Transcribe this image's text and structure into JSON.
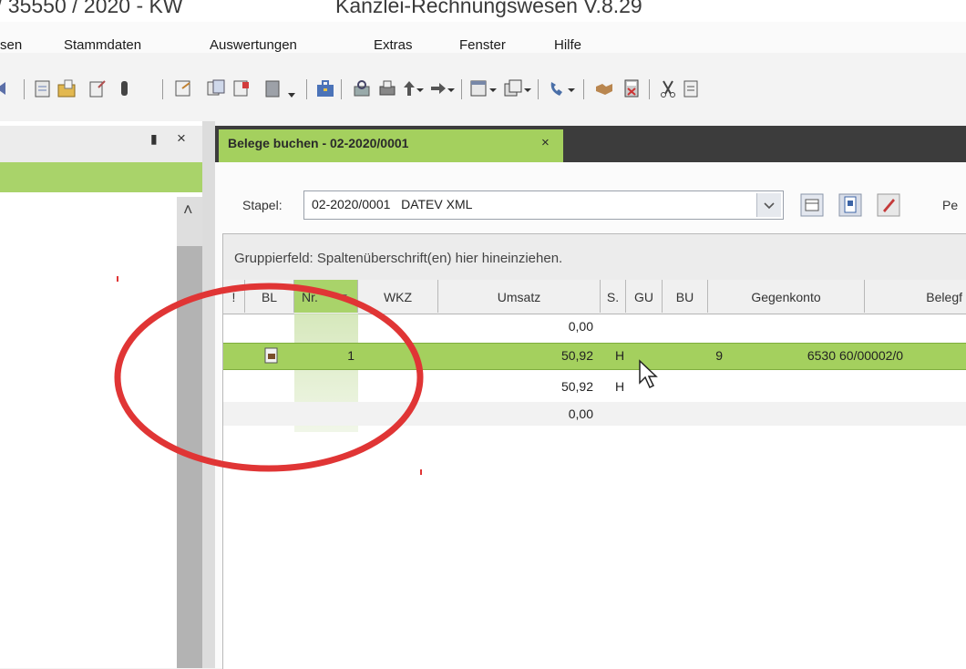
{
  "window": {
    "title": "/ 35550 / 2020 - KW",
    "app_title": "Kanzlei-Rechnungswesen V.8.29"
  },
  "menu": [
    "sen",
    "Stammdaten",
    "Auswertungen",
    "Extras",
    "Fenster",
    "Hilfe"
  ],
  "toolbar": {
    "icons": [
      "arrow-icon",
      "document-icon",
      "folder-open-icon",
      "document-edit-icon",
      "attach-icon",
      "page-icon",
      "copy-icon",
      "page-delete-icon",
      "archive-icon",
      "dropdown-icon",
      "briefcase-icon",
      "print-preview-icon",
      "printer-icon",
      "arrow-up-icon",
      "arrow-right-icon",
      "window-icon",
      "window-stack-icon",
      "phone-icon",
      "handshake-icon",
      "calculator-icon",
      "scissors-icon",
      "clipboard-icon"
    ]
  },
  "left_panel": {
    "pin_label": "▮",
    "close_label": "×",
    "scroll_up": "˄"
  },
  "doc_tab": {
    "label": "Belege buchen  - 02-2020/0001",
    "close": "×"
  },
  "stapel": {
    "label": "Stapel:",
    "value": "02-2020/0001   DATEV XML",
    "extra": "Pe"
  },
  "grid": {
    "group_hint": "Gruppierfeld: Spaltenüberschrift(en) hier hineinziehen.",
    "columns": [
      "!",
      "BL",
      "Nr.",
      "WKZ",
      "Umsatz",
      "S.",
      "GU",
      "BU",
      "Gegenkonto",
      "Belegf"
    ],
    "rows": [
      {
        "bl": "",
        "nr": "",
        "umsatz": "0,00",
        "s": "",
        "bu": "",
        "gegenkonto": "",
        "beleg": ""
      },
      {
        "bl": "doc",
        "nr": "1",
        "umsatz": "50,92",
        "s": "H",
        "bu": "9",
        "gegenkonto": "6530",
        "beleg": "60/00002/0"
      },
      {
        "bl": "",
        "nr": "",
        "umsatz": "50,92",
        "s": "H",
        "bu": "",
        "gegenkonto": "",
        "beleg": ""
      },
      {
        "bl": "",
        "nr": "",
        "umsatz": "0,00",
        "s": "",
        "bu": "",
        "gegenkonto": "",
        "beleg": ""
      }
    ]
  },
  "colors": {
    "accent_green": "#a4d05e",
    "annotation_red": "#e03535",
    "dark_tabstrip": "#3c3c3c"
  }
}
